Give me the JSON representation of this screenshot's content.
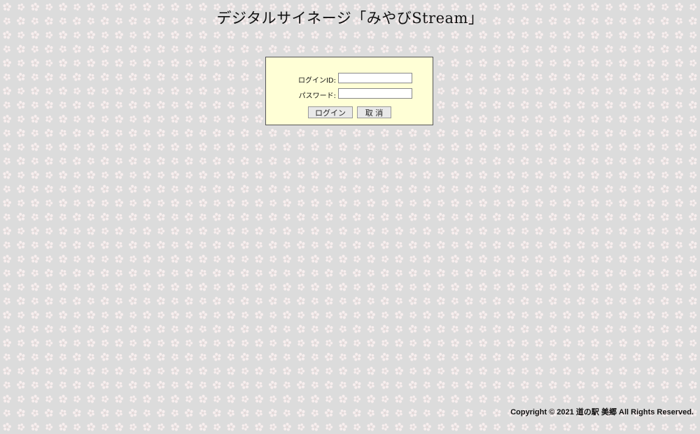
{
  "title": "デジタルサイネージ「みやびStream」",
  "login": {
    "id_label": "ログインID:",
    "id_value": "",
    "password_label": "パスワード:",
    "password_value": "",
    "login_button": "ログイン",
    "cancel_button": "取 消"
  },
  "footer": {
    "copyright": "Copyright © 2021 道の駅 美郷 All Rights Reserved."
  },
  "colors": {
    "background": "#dcdcdc",
    "blossom": "#f8eeee",
    "panel": "#ffffd6"
  }
}
